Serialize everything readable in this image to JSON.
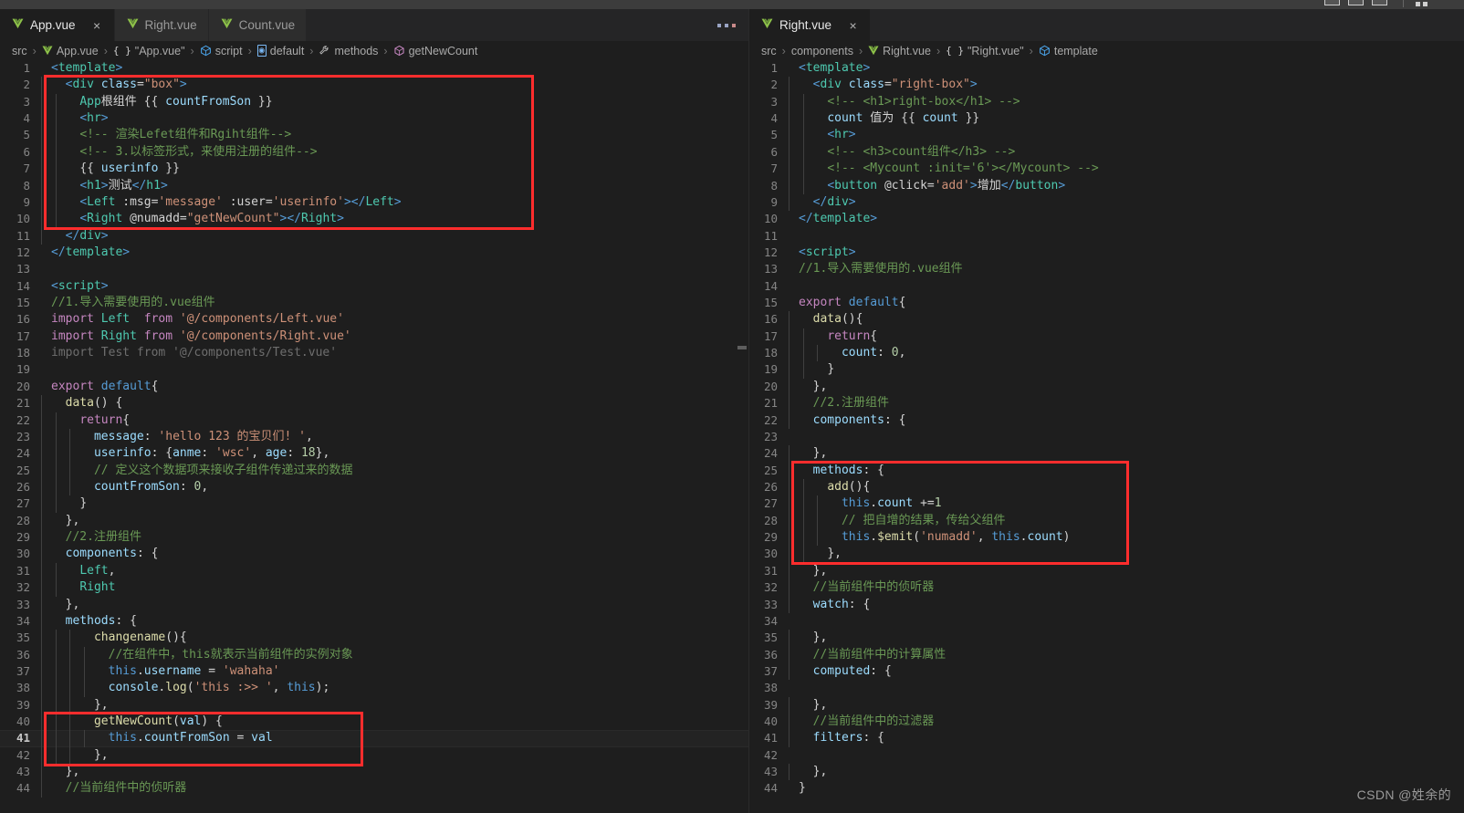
{
  "window": {
    "layout_icons": [
      "split-editor-icon",
      "panel-icon",
      "layout-icon"
    ],
    "more_actions_icon": "more-actions-icon"
  },
  "watermark": "CSDN @姓余的",
  "left_pane": {
    "tabs": [
      {
        "label": "App.vue",
        "icon": "vue-file-icon",
        "active": true,
        "closable": true,
        "close_label": "×"
      },
      {
        "label": "Right.vue",
        "icon": "vue-file-icon",
        "active": false,
        "closable": false,
        "close_label": ""
      },
      {
        "label": "Count.vue",
        "icon": "vue-file-icon",
        "active": false,
        "closable": false,
        "close_label": ""
      }
    ],
    "more_label": "···",
    "breadcrumb": [
      {
        "label": "src",
        "icon": ""
      },
      {
        "label": "App.vue",
        "icon": "vue-file-icon"
      },
      {
        "label": "\"App.vue\"",
        "icon": "braces-icon"
      },
      {
        "label": "script",
        "icon": "symbol-module-icon"
      },
      {
        "label": "default",
        "icon": "symbol-object-icon"
      },
      {
        "label": "methods",
        "icon": "symbol-wrench-icon"
      },
      {
        "label": "getNewCount",
        "icon": "symbol-method-icon"
      }
    ],
    "separator": "›",
    "current_line": 41,
    "lines": [
      {
        "n": 1,
        "text": "<template>"
      },
      {
        "n": 2,
        "text": "  <div class=\"box\">"
      },
      {
        "n": 3,
        "text": "    App根组件 {{ countFromSon }}"
      },
      {
        "n": 4,
        "text": "    <hr>"
      },
      {
        "n": 5,
        "text": "    <!-- 渲染Lefet组件和Rgiht组件-->"
      },
      {
        "n": 6,
        "text": "    <!-- 3.以标签形式，来使用注册的组件-->"
      },
      {
        "n": 7,
        "text": "    {{ userinfo }}"
      },
      {
        "n": 8,
        "text": "    <h1>测试</h1>"
      },
      {
        "n": 9,
        "text": "    <Left :msg='message' :user='userinfo'></Left>"
      },
      {
        "n": 10,
        "text": "    <Right @numadd=\"getNewCount\"></Right>"
      },
      {
        "n": 11,
        "text": "  </div>"
      },
      {
        "n": 12,
        "text": "</template>"
      },
      {
        "n": 13,
        "text": ""
      },
      {
        "n": 14,
        "text": "<script>"
      },
      {
        "n": 15,
        "text": "//1.导入需要使用的.vue组件"
      },
      {
        "n": 16,
        "text": "import Left  from '@/components/Left.vue'"
      },
      {
        "n": 17,
        "text": "import Right from '@/components/Right.vue'"
      },
      {
        "n": 18,
        "text": "import Test from '@/components/Test.vue'"
      },
      {
        "n": 19,
        "text": ""
      },
      {
        "n": 20,
        "text": "export default{"
      },
      {
        "n": 21,
        "text": "  data() {"
      },
      {
        "n": 22,
        "text": "    return{"
      },
      {
        "n": 23,
        "text": "      message: 'hello 123 的宝贝们! ',"
      },
      {
        "n": 24,
        "text": "      userinfo: {anme: 'wsc', age: 18},"
      },
      {
        "n": 25,
        "text": "      // 定义这个数据项来接收子组件传递过来的数据"
      },
      {
        "n": 26,
        "text": "      countFromSon: 0,"
      },
      {
        "n": 27,
        "text": "    }"
      },
      {
        "n": 28,
        "text": "  },"
      },
      {
        "n": 29,
        "text": "  //2.注册组件"
      },
      {
        "n": 30,
        "text": "  components: {"
      },
      {
        "n": 31,
        "text": "    Left,"
      },
      {
        "n": 32,
        "text": "    Right"
      },
      {
        "n": 33,
        "text": "  },"
      },
      {
        "n": 34,
        "text": "  methods: {"
      },
      {
        "n": 35,
        "text": "      changename(){"
      },
      {
        "n": 36,
        "text": "        //在组件中，this就表示当前组件的实例对象"
      },
      {
        "n": 37,
        "text": "        this.username = 'wahaha'"
      },
      {
        "n": 38,
        "text": "        console.log('this :>> ', this);"
      },
      {
        "n": 39,
        "text": "      },"
      },
      {
        "n": 40,
        "text": "      getNewCount(val) {"
      },
      {
        "n": 41,
        "text": "        this.countFromSon = val"
      },
      {
        "n": 42,
        "text": "      },"
      },
      {
        "n": 43,
        "text": "  },"
      },
      {
        "n": 44,
        "text": "  //当前组件中的侦听器"
      }
    ],
    "highlight_boxes": [
      {
        "name": "template-block-highlight",
        "from_line": 2,
        "to_line": 10,
        "color": "#ff2d2d"
      },
      {
        "name": "getnewcount-method-highlight",
        "from_line": 40,
        "to_line": 42,
        "color": "#ff2d2d"
      }
    ]
  },
  "right_pane": {
    "tabs": [
      {
        "label": "Right.vue",
        "icon": "vue-file-icon",
        "active": true,
        "closable": true,
        "close_label": "×"
      }
    ],
    "breadcrumb": [
      {
        "label": "src",
        "icon": ""
      },
      {
        "label": "components",
        "icon": ""
      },
      {
        "label": "Right.vue",
        "icon": "vue-file-icon"
      },
      {
        "label": "\"Right.vue\"",
        "icon": "braces-icon"
      },
      {
        "label": "template",
        "icon": "symbol-module-icon"
      }
    ],
    "separator": "›",
    "current_line": 0,
    "lines": [
      {
        "n": 1,
        "text": "<template>"
      },
      {
        "n": 2,
        "text": "  <div class=\"right-box\">"
      },
      {
        "n": 3,
        "text": "    <!-- <h1>right-box</h1> -->"
      },
      {
        "n": 4,
        "text": "    count 值为 {{ count }}"
      },
      {
        "n": 5,
        "text": "    <hr>"
      },
      {
        "n": 6,
        "text": "    <!-- <h3>count组件</h3> -->"
      },
      {
        "n": 7,
        "text": "    <!-- <Mycount :init='6'></Mycount> -->"
      },
      {
        "n": 8,
        "text": "    <button @click='add'>增加</button>"
      },
      {
        "n": 9,
        "text": "  </div>"
      },
      {
        "n": 10,
        "text": "</template>"
      },
      {
        "n": 11,
        "text": ""
      },
      {
        "n": 12,
        "text": "<script>"
      },
      {
        "n": 13,
        "text": "//1.导入需要使用的.vue组件"
      },
      {
        "n": 14,
        "text": ""
      },
      {
        "n": 15,
        "text": "export default{"
      },
      {
        "n": 16,
        "text": "  data(){"
      },
      {
        "n": 17,
        "text": "    return{"
      },
      {
        "n": 18,
        "text": "      count: 0,"
      },
      {
        "n": 19,
        "text": "    }"
      },
      {
        "n": 20,
        "text": "  },"
      },
      {
        "n": 21,
        "text": "  //2.注册组件"
      },
      {
        "n": 22,
        "text": "  components: {"
      },
      {
        "n": 23,
        "text": ""
      },
      {
        "n": 24,
        "text": "  },"
      },
      {
        "n": 25,
        "text": "  methods: {"
      },
      {
        "n": 26,
        "text": "    add(){"
      },
      {
        "n": 27,
        "text": "      this.count +=1"
      },
      {
        "n": 28,
        "text": "      // 把自增的结果，传给父组件"
      },
      {
        "n": 29,
        "text": "      this.$emit('numadd', this.count)"
      },
      {
        "n": 30,
        "text": "    },"
      },
      {
        "n": 31,
        "text": "  },"
      },
      {
        "n": 32,
        "text": "  //当前组件中的侦听器"
      },
      {
        "n": 33,
        "text": "  watch: {"
      },
      {
        "n": 34,
        "text": ""
      },
      {
        "n": 35,
        "text": "  },"
      },
      {
        "n": 36,
        "text": "  //当前组件中的计算属性"
      },
      {
        "n": 37,
        "text": "  computed: {"
      },
      {
        "n": 38,
        "text": ""
      },
      {
        "n": 39,
        "text": "  },"
      },
      {
        "n": 40,
        "text": "  //当前组件中的过滤器"
      },
      {
        "n": 41,
        "text": "  filters: {"
      },
      {
        "n": 42,
        "text": ""
      },
      {
        "n": 43,
        "text": "  },"
      },
      {
        "n": 44,
        "text": "}"
      }
    ],
    "highlight_boxes": [
      {
        "name": "methods-block-highlight",
        "from_line": 25,
        "to_line": 30,
        "color": "#ff2d2d"
      }
    ]
  }
}
